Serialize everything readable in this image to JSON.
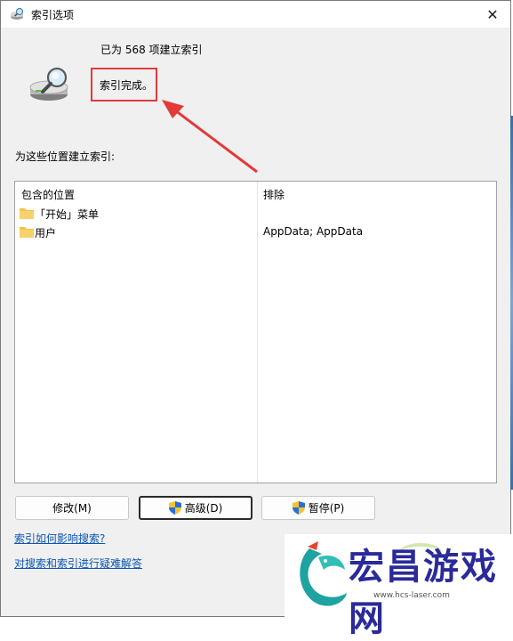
{
  "window": {
    "title": "索引选项",
    "close_glyph": "✕"
  },
  "status": {
    "count_text": "已为 568 项建立索引",
    "state_text": "索引完成。"
  },
  "locations": {
    "label": "为这些位置建立索引:",
    "columns": {
      "included": "包含的位置",
      "exclude": "排除"
    },
    "rows": [
      {
        "name": "「开始」菜单",
        "exclude": ""
      },
      {
        "name": "用户",
        "exclude": "AppData; AppData"
      }
    ]
  },
  "buttons": {
    "modify": "修改(M)",
    "advanced": "高级(D)",
    "pause": "暂停(P)"
  },
  "links": {
    "how_indexing": "索引如何影响搜索?",
    "troubleshoot": "对搜索和索引进行疑难解答"
  },
  "watermark": {
    "title": "宏昌游戏网",
    "url": "www.hcs-laser.com"
  },
  "colors": {
    "highlight_box": "#e23a3a",
    "link": "#0a56b5",
    "folder": "#f2c14e",
    "watermark_text": "#2a2a9a"
  },
  "icons": {
    "title_icon": "indexing-options-icon",
    "drive": "indexing-drive-icon",
    "folder": "folder-icon",
    "shield": "uac-shield-icon",
    "close": "close-icon"
  }
}
